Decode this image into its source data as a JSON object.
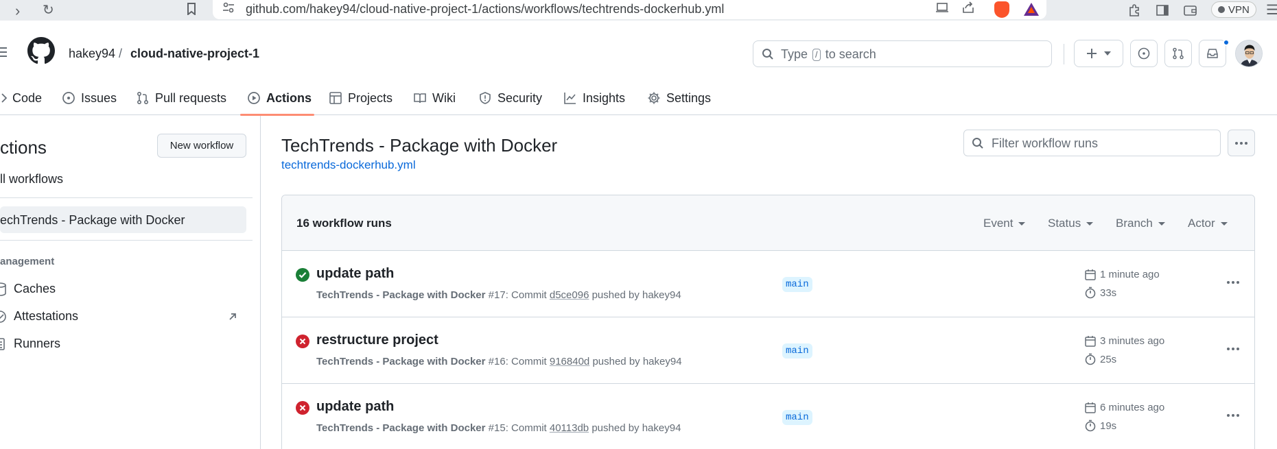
{
  "browser": {
    "url": "github.com/hakey94/cloud-native-project-1/actions/workflows/techtrends-dockerhub.yml",
    "vpn_label": "VPN"
  },
  "header": {
    "owner": "hakey94",
    "separator": "/",
    "repo": "cloud-native-project-1",
    "search_prefix": "Type",
    "search_key": "/",
    "search_suffix": "to search"
  },
  "tabs": [
    {
      "label": "Code",
      "icon": "code-icon"
    },
    {
      "label": "Issues",
      "icon": "issue-icon"
    },
    {
      "label": "Pull requests",
      "icon": "pull-request-icon"
    },
    {
      "label": "Actions",
      "icon": "play-icon",
      "active": true
    },
    {
      "label": "Projects",
      "icon": "table-icon"
    },
    {
      "label": "Wiki",
      "icon": "book-icon"
    },
    {
      "label": "Security",
      "icon": "shield-icon"
    },
    {
      "label": "Insights",
      "icon": "graph-icon"
    },
    {
      "label": "Settings",
      "icon": "gear-icon"
    }
  ],
  "sidebar": {
    "title": "ctions",
    "new_workflow": "New workflow",
    "all_workflows": "ll workflows",
    "selected_workflow": "echTrends - Package with Docker",
    "management_heading": "anagement",
    "items": [
      {
        "label": "Caches",
        "icon": "cache-icon"
      },
      {
        "label": "Attestations",
        "icon": "verified-icon"
      },
      {
        "label": "Runners",
        "icon": "server-icon"
      }
    ]
  },
  "main": {
    "title": "TechTrends - Package with Docker",
    "file_link": "techtrends-dockerhub.yml",
    "filter_placeholder": "Filter workflow runs",
    "runs_count": "16 workflow runs",
    "filters": [
      "Event",
      "Status",
      "Branch",
      "Actor"
    ]
  },
  "runs": [
    {
      "status": "success",
      "title": "update path",
      "workflow": "TechTrends - Package with Docker",
      "run_number": "#17",
      "commit_label": ": Commit",
      "sha": "d5ce096",
      "pushed_by": "pushed by hakey94",
      "branch": "main",
      "time_ago": "1 minute ago",
      "duration": "33s"
    },
    {
      "status": "failure",
      "title": "restructure project",
      "workflow": "TechTrends - Package with Docker",
      "run_number": "#16",
      "commit_label": ": Commit",
      "sha": "916840d",
      "pushed_by": "pushed by hakey94",
      "branch": "main",
      "time_ago": "3 minutes ago",
      "duration": "25s"
    },
    {
      "status": "failure",
      "title": "update path",
      "workflow": "TechTrends - Package with Docker",
      "run_number": "#15",
      "commit_label": ": Commit",
      "sha": "40113db",
      "pushed_by": "pushed by hakey94",
      "branch": "main",
      "time_ago": "6 minutes ago",
      "duration": "19s"
    }
  ],
  "colors": {
    "success": "#1a7f37",
    "failure": "#cf222e",
    "accent": "#0969da",
    "active_tab_underline": "#fd8c73"
  }
}
